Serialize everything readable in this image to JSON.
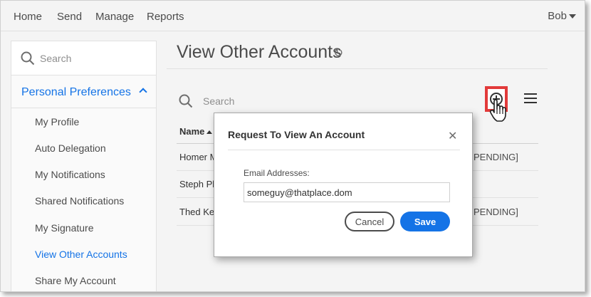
{
  "topnav": {
    "items": [
      "Home",
      "Send",
      "Manage",
      "Reports"
    ],
    "user": "Bob"
  },
  "sidebar": {
    "search_placeholder": "Search",
    "section_label": "Personal Preferences",
    "items": [
      {
        "label": "My Profile"
      },
      {
        "label": "Auto Delegation"
      },
      {
        "label": "My Notifications"
      },
      {
        "label": "Shared Notifications"
      },
      {
        "label": "My Signature"
      },
      {
        "label": "View Other Accounts",
        "active": true
      },
      {
        "label": "Share My Account"
      }
    ]
  },
  "main": {
    "title": "View Other Accounts",
    "search_placeholder": "Search",
    "table": {
      "header_name": "Name",
      "rows": [
        {
          "name": "Homer M",
          "status": "PENDING]"
        },
        {
          "name": "Steph Ph",
          "status": ""
        },
        {
          "name": "Thed Ke",
          "status": "PENDING]"
        }
      ]
    }
  },
  "modal": {
    "title": "Request To View An Account",
    "field_label": "Email Addresses:",
    "field_value": "someguy@thatplace.dom",
    "cancel_label": "Cancel",
    "save_label": "Save"
  },
  "colors": {
    "accent": "#1473e6",
    "highlight": "#e23a3a"
  }
}
